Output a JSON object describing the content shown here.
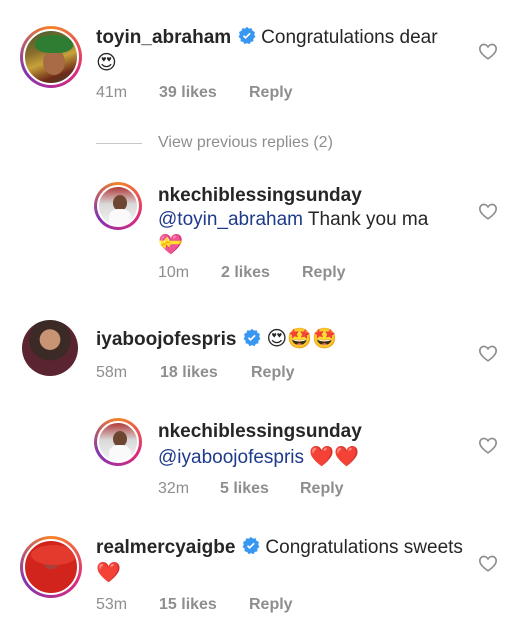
{
  "comments": [
    {
      "username": "toyin_abraham",
      "verified": true,
      "mention": "",
      "text": "Congratulations dear",
      "emoji": "😍",
      "time": "41m",
      "likes": "39 likes",
      "reply": "Reply"
    },
    {
      "username": "nkechiblessingsunday",
      "verified": false,
      "mention": "@toyin_abraham",
      "text": "Thank you ma",
      "emoji": "💝",
      "time": "10m",
      "likes": "2 likes",
      "reply": "Reply"
    },
    {
      "username": "iyaboojofespris",
      "verified": true,
      "mention": "",
      "text": "",
      "emoji": "😍🤩🤩",
      "time": "58m",
      "likes": "18 likes",
      "reply": "Reply"
    },
    {
      "username": "nkechiblessingsunday",
      "verified": false,
      "mention": "@iyaboojofespris",
      "text": "",
      "emoji": "❤️❤️",
      "time": "32m",
      "likes": "5 likes",
      "reply": "Reply"
    },
    {
      "username": "realmercyaigbe",
      "verified": true,
      "mention": "",
      "text": "Congratulations sweets",
      "emoji": "❤️",
      "time": "53m",
      "likes": "15 likes",
      "reply": "Reply"
    }
  ],
  "view_previous": "View previous replies (2)",
  "colors": {
    "verified_blue": "#3897f0",
    "mention_blue": "#1e3a8a",
    "meta_grey": "#8e8e8e",
    "heart_outline": "#8e8e8e"
  }
}
